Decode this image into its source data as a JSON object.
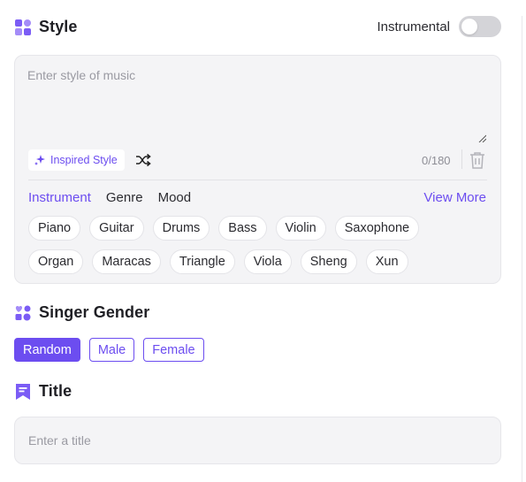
{
  "style_section": {
    "title": "Style",
    "icon": "grid-shapes-icon",
    "instrumental_label": "Instrumental",
    "instrumental_on": false,
    "input_placeholder": "Enter style of music",
    "inspired_label": "Inspired Style",
    "counter": "0/180",
    "tabs": [
      {
        "label": "Instrument",
        "active": true
      },
      {
        "label": "Genre",
        "active": false
      },
      {
        "label": "Mood",
        "active": false
      }
    ],
    "view_more": "View More",
    "chip_rows": [
      [
        "Piano",
        "Guitar",
        "Drums",
        "Bass",
        "Violin",
        "Saxophone"
      ],
      [
        "Organ",
        "Maracas",
        "Triangle",
        "Viola",
        "Sheng",
        "Xun"
      ]
    ]
  },
  "gender_section": {
    "title": "Singer Gender",
    "icon": "gender-shapes-icon",
    "options": [
      {
        "label": "Random",
        "selected": true
      },
      {
        "label": "Male",
        "selected": false
      },
      {
        "label": "Female",
        "selected": false
      }
    ]
  },
  "title_section": {
    "title": "Title",
    "icon": "bookmark-title-icon",
    "input_placeholder": "Enter a title"
  },
  "colors": {
    "accent": "#6c4df0",
    "panel": "#f4f4f6",
    "icon_purple": "#7b5cf5"
  }
}
